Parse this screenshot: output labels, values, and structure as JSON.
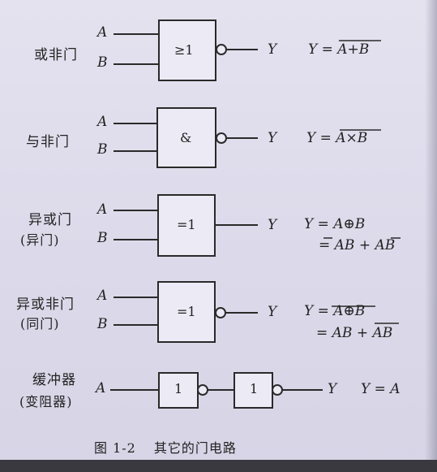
{
  "rows": [
    {
      "name": "或非门",
      "name2": "",
      "inputs": [
        "A",
        "B"
      ],
      "symbol": "≥1",
      "output": "Y",
      "eq1": "Y = A+B",
      "eq2": ""
    },
    {
      "name": "与非门",
      "name2": "",
      "inputs": [
        "A",
        "B"
      ],
      "symbol": "&",
      "output": "Y",
      "eq1": "Y = A×B",
      "eq2": ""
    },
    {
      "name": "异或门",
      "name2": "(异门)",
      "inputs": [
        "A",
        "B"
      ],
      "symbol": "=1",
      "output": "Y",
      "eq1": "Y = A⊕B",
      "eq2": "= AB + AB"
    },
    {
      "name": "异或非门",
      "name2": "(同门)",
      "inputs": [
        "A",
        "B"
      ],
      "symbol": "=1",
      "output": "Y",
      "eq1": "Y = A⊕B",
      "eq2": "= AB + AB"
    },
    {
      "name": "缓冲器",
      "name2": "(变阻器)",
      "inputs": [
        "A"
      ],
      "symbol": "1",
      "symbol2": "1",
      "output": "Y",
      "eq1": "Y = A",
      "eq2": ""
    }
  ],
  "caption": {
    "number": "图 1-2",
    "title": "其它的门电路"
  }
}
